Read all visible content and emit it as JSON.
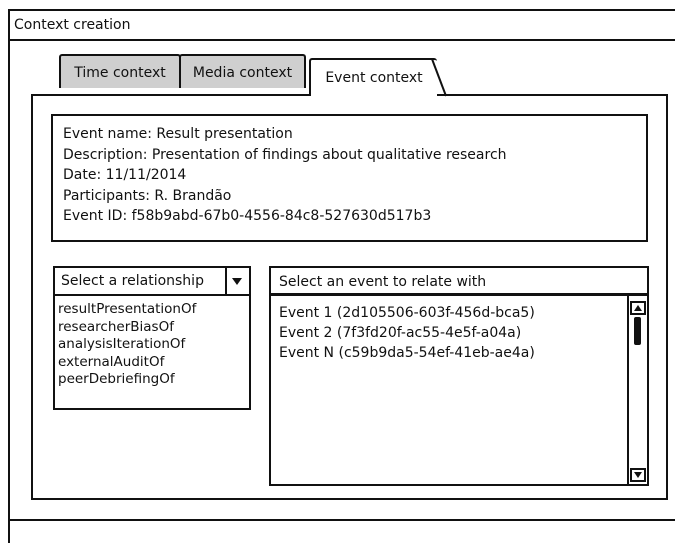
{
  "window": {
    "title": "Context creation"
  },
  "tabs": [
    {
      "label": "Time context",
      "active": false
    },
    {
      "label": "Media context",
      "active": false
    },
    {
      "label": "Event context",
      "active": true
    }
  ],
  "event_info": {
    "lines": [
      "Event name: Result presentation",
      "Description: Presentation of findings about qualitative research",
      "Date: 11/11/2014",
      "Participants: R. Brandão",
      "Event ID: f58b9abd-67b0-4556-84c8-527630d517b3"
    ]
  },
  "relationship": {
    "select_label": "Select a relationship",
    "options": [
      "resultPresentationOf",
      "researcherBiasOf",
      "analysisIterationOf",
      "externalAuditOf",
      "peerDebriefingOf"
    ]
  },
  "event_select": {
    "header": "Select an event to relate with",
    "items": [
      "Event 1 (2d105506-603f-456d-bca5)",
      "Event 2 (7f3fd20f-ac55-4e5f-a04a)",
      "Event N (c59b9da5-54ef-41eb-ae4a)"
    ]
  },
  "icons": {
    "dropdown": "chevron-down-icon",
    "scroll_up": "scroll-up-icon",
    "scroll_down": "scroll-down-icon"
  }
}
